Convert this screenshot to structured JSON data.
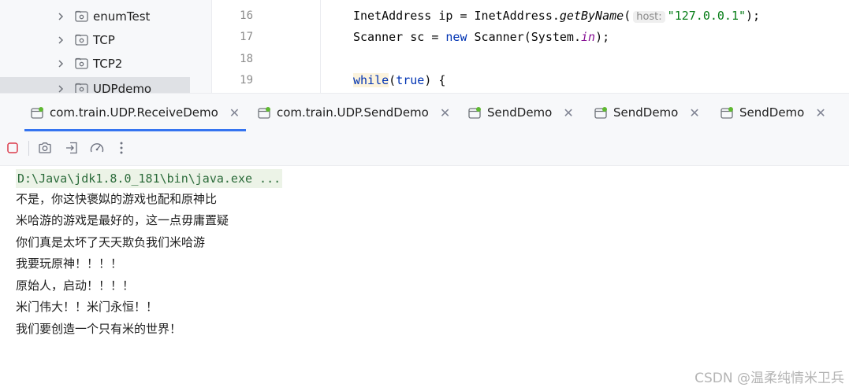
{
  "project_tree": {
    "items": [
      {
        "label": "enumTest",
        "icon": "package-folder-icon"
      },
      {
        "label": "TCP",
        "icon": "package-folder-icon"
      },
      {
        "label": "TCP2",
        "icon": "package-folder-icon"
      },
      {
        "label": "UDPdemo",
        "icon": "package-folder-icon",
        "selected": true
      }
    ]
  },
  "editor": {
    "line_numbers": [
      "16",
      "17",
      "18",
      "19"
    ],
    "lines": {
      "l16": {
        "type": "InetAddress ip = InetAddress.",
        "method": "getByName",
        "open": "(",
        "hint": "host:",
        "string": "\"127.0.0.1\"",
        "close": ");"
      },
      "l17": {
        "pre": "Scanner sc = ",
        "kw": "new",
        "mid": " Scanner(System.",
        "field": "in",
        "close": ");"
      },
      "l19": {
        "kw": "while",
        "open": "(",
        "kw2": "true",
        "close": ") {"
      }
    }
  },
  "run_tabs": [
    {
      "label": "com.train.UDP.ReceiveDemo",
      "active": true
    },
    {
      "label": "com.train.UDP.SendDemo",
      "active": false
    },
    {
      "label": "SendDemo",
      "active": false
    },
    {
      "label": "SendDemo",
      "active": false
    },
    {
      "label": "SendDemo",
      "active": false
    }
  ],
  "toolbar": {
    "buttons": [
      "stop-icon",
      "camera-icon",
      "exit-icon",
      "gauge-icon",
      "more-vertical-icon"
    ]
  },
  "console": {
    "command": "D:\\Java\\jdk1.8.0_181\\bin\\java.exe ...",
    "output": [
      "不是，你这快褒姒的游戏也配和原神比",
      "米哈游的游戏是最好的，这一点毋庸置疑",
      "你们真是太坏了天天欺负我们米哈游",
      "我要玩原神！！！！",
      "原始人，启动！！！！",
      "米门伟大！！米门永恒！！",
      "我们要创造一个只有米的世界！"
    ]
  },
  "watermark": "CSDN @温柔纯情米卫兵",
  "colors": {
    "accent": "#3574f0",
    "stop_red": "#db3b4b",
    "run_green": "#5fb832",
    "keyword": "#0033b3",
    "string": "#067d17"
  }
}
